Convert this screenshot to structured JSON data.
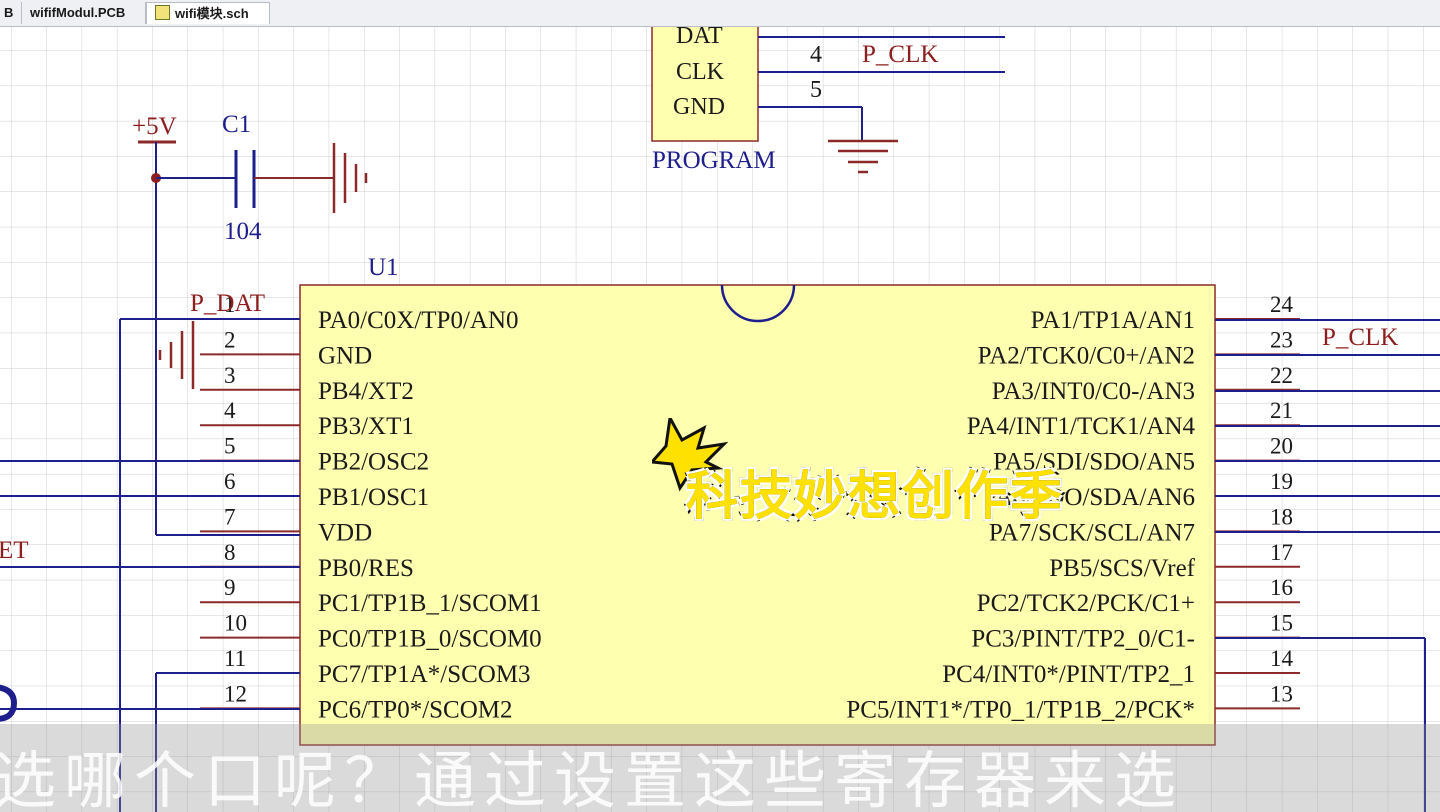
{
  "tabs": [
    {
      "label": "B",
      "active": false
    },
    {
      "label": "wififModul.PCB",
      "active": false
    },
    {
      "label": "wifi模块.sch",
      "active": true
    }
  ],
  "schematic": {
    "program_pins": {
      "dat": "DAT",
      "clk": "CLK",
      "gnd": "GND"
    },
    "program_label": "PROGRAM",
    "program_pin_numbers": [
      "4",
      "5"
    ],
    "net_p_clk": "P_CLK",
    "power_label": "+5V",
    "cap_ref": "C1",
    "cap_value": "104",
    "chip_ref": "U1",
    "net_p_dat": "P_DAT",
    "net_reset_fragment": "ET",
    "left_pins": [
      {
        "num": "1",
        "name": "PA0/C0X/TP0/AN0"
      },
      {
        "num": "2",
        "name": "GND"
      },
      {
        "num": "3",
        "name": "PB4/XT2"
      },
      {
        "num": "4",
        "name": "PB3/XT1"
      },
      {
        "num": "5",
        "name": "PB2/OSC2"
      },
      {
        "num": "6",
        "name": "PB1/OSC1"
      },
      {
        "num": "7",
        "name": "VDD"
      },
      {
        "num": "8",
        "name": "PB0/RES"
      },
      {
        "num": "9",
        "name": "PC1/TP1B_1/SCOM1"
      },
      {
        "num": "10",
        "name": "PC0/TP1B_0/SCOM0"
      },
      {
        "num": "11",
        "name": "PC7/TP1A*/SCOM3"
      },
      {
        "num": "12",
        "name": "PC6/TP0*/SCOM2"
      }
    ],
    "right_pins": [
      {
        "num": "24",
        "name": "PA1/TP1A/AN1"
      },
      {
        "num": "23",
        "name": "PA2/TCK0/C0+/AN2"
      },
      {
        "num": "22",
        "name": "PA3/INT0/C0-/AN3"
      },
      {
        "num": "21",
        "name": "PA4/INT1/TCK1/AN4"
      },
      {
        "num": "20",
        "name": "PA5/SDI/SDO/AN5"
      },
      {
        "num": "19",
        "name": "PA6/SDO/SDA/AN6"
      },
      {
        "num": "18",
        "name": "PA7/SCK/SCL/AN7"
      },
      {
        "num": "17",
        "name": "PB5/SCS/Vref"
      },
      {
        "num": "16",
        "name": "PC2/TCK2/PCK/C1+"
      },
      {
        "num": "15",
        "name": "PC3/PINT/TP2_0/C1-"
      },
      {
        "num": "14",
        "name": "PC4/INT0*/PINT/TP2_1"
      },
      {
        "num": "13",
        "name": "PC5/INT1*/TP0_1/TP1B_2/PCK*"
      }
    ]
  },
  "overlay": {
    "sticker_text": "科技妙想创作季",
    "subtitle_text": "选哪个口呢？通过设置这些寄存器来选"
  },
  "colors": {
    "grid": "#cfcfcf",
    "wire": "#1e1e8c",
    "part_fill": "#ffffb0",
    "part_border": "#8c2a2a",
    "net_label": "#8c1e1e",
    "sticker": "#ffe100"
  }
}
